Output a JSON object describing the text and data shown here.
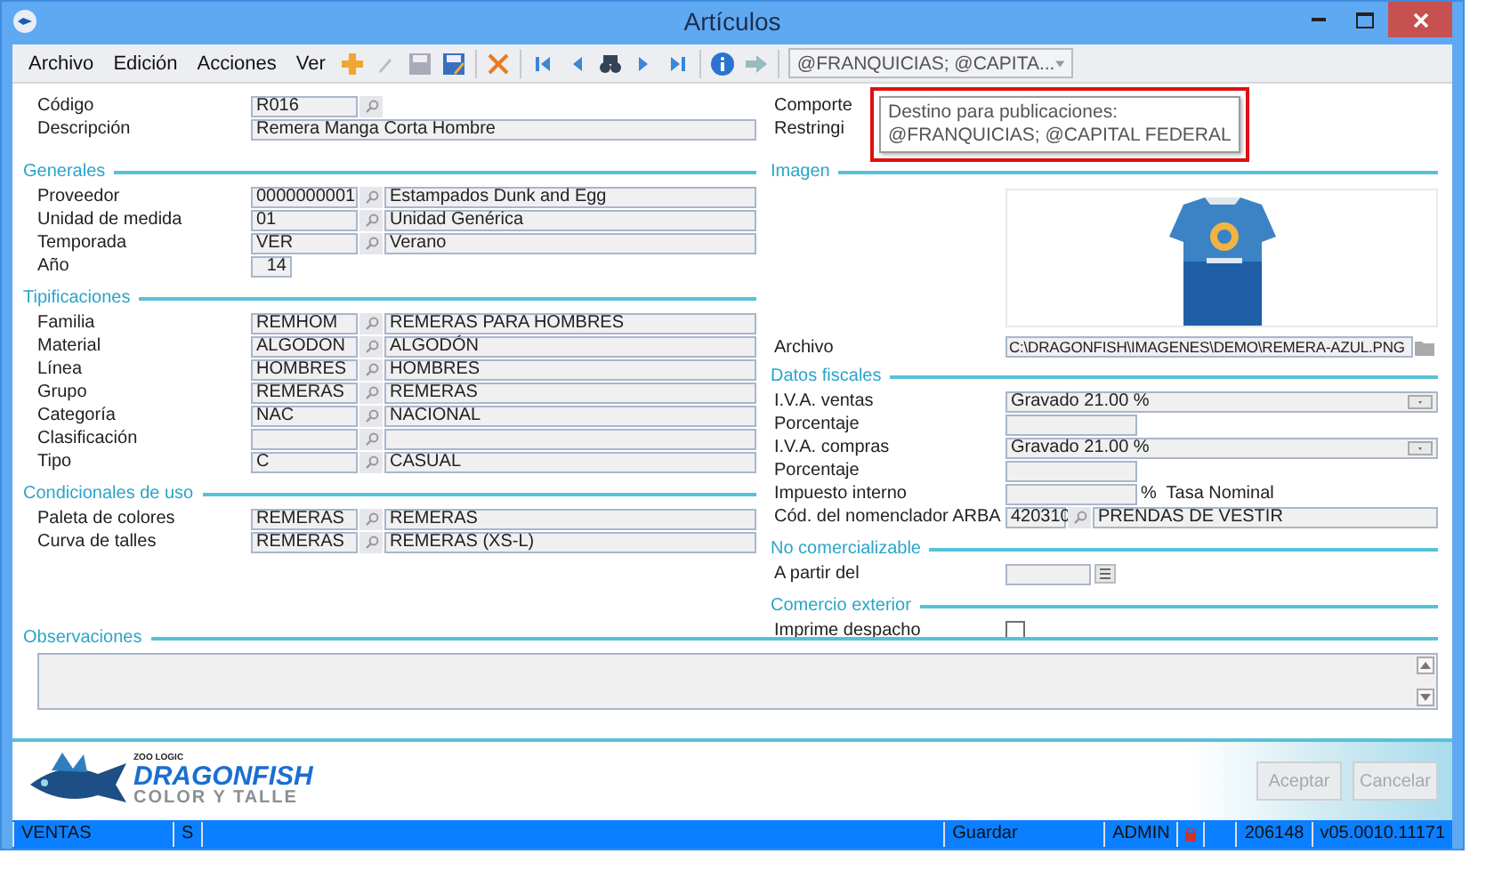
{
  "window": {
    "title": "Artículos"
  },
  "menu": [
    "Archivo",
    "Edición",
    "Acciones",
    "Ver"
  ],
  "toolbar": {
    "combo": "@FRANQUICIAS; @CAPITA..."
  },
  "tooltip": {
    "highlighted": true,
    "lines": [
      "Destino para publicaciones:",
      "@FRANQUICIAS; @CAPITAL FEDERAL"
    ]
  },
  "header_fields": [
    {
      "label": "Código",
      "value": "R016",
      "kind": "code"
    },
    {
      "label": "Descripción",
      "value": "Remera Manga Corta Hombre",
      "kind": "text"
    }
  ],
  "left_sections": [
    {
      "title": "Generales",
      "rows": [
        {
          "kind": "lookup",
          "label": "Proveedor",
          "code": "0000000001",
          "description": "Estampados Dunk and Egg"
        },
        {
          "kind": "lookup",
          "label": "Unidad de medida",
          "code": "01",
          "description": "Unidad Genérica"
        },
        {
          "kind": "lookup",
          "label": "Temporada",
          "code": "VER",
          "description": "Verano"
        },
        {
          "kind": "number",
          "label": "Año",
          "code": "14"
        }
      ]
    },
    {
      "title": "Tipificaciones",
      "rows": [
        {
          "kind": "lookup",
          "label": "Familia",
          "code": "REMHOM",
          "description": "REMERAS PARA HOMBRES"
        },
        {
          "kind": "lookup",
          "label": "Material",
          "code": "ALGODON",
          "description": "ALGODÓN"
        },
        {
          "kind": "lookup",
          "label": "Línea",
          "code": "HOMBRES",
          "description": "HOMBRES"
        },
        {
          "kind": "lookup",
          "label": "Grupo",
          "code": "REMERAS",
          "description": "REMERAS"
        },
        {
          "kind": "lookup",
          "label": "Categoría",
          "code": "NAC",
          "description": "NACIONAL"
        },
        {
          "kind": "lookup",
          "label": "Clasificación"
        },
        {
          "kind": "lookup",
          "label": "Tipo",
          "code": "C",
          "description": "CASUAL"
        }
      ]
    },
    {
      "title": "Condicionales de uso",
      "rows": [
        {
          "kind": "lookup",
          "label": "Paleta de colores",
          "code": "REMERAS",
          "description": "REMERAS"
        },
        {
          "kind": "lookup",
          "label": "Curva de talles",
          "code": "REMERAS",
          "description": "REMERAS (XS-L)"
        }
      ]
    }
  ],
  "right_top_labels": [
    "Comporte",
    "Restringi"
  ],
  "image_section": {
    "title": "Imagen",
    "file_label": "Archivo",
    "file": "C:\\DRAGONFISH\\IMAGENES\\DEMO\\REMERA-AZUL.PNG"
  },
  "right_sections": [
    {
      "title": "Datos fiscales",
      "rows": [
        {
          "kind": "select",
          "label": "I.V.A. ventas",
          "value": "Gravado 21.00 %"
        },
        {
          "kind": "input",
          "label": "Porcentaje"
        },
        {
          "kind": "select",
          "label": "I.V.A. compras",
          "value": "Gravado 21.00 %"
        },
        {
          "kind": "input",
          "label": "Porcentaje"
        },
        {
          "kind": "suffix",
          "label": "Impuesto interno",
          "suffix": "%  Tasa Nominal"
        },
        {
          "kind": "lookup",
          "label": "Cód. del nomenclador ARBA",
          "code": "420310",
          "description": "PRENDAS DE VESTIR"
        }
      ]
    },
    {
      "title": "No comercializable",
      "rows": [
        {
          "kind": "date",
          "label": "A partir del"
        }
      ]
    },
    {
      "title": "Comercio exterior",
      "rows": [
        {
          "kind": "checkbox",
          "label": "Imprime despacho",
          "checked": false
        }
      ]
    }
  ],
  "observaciones": {
    "title": "Observaciones"
  },
  "logo": {
    "brand": "ZOO LOGIC",
    "name": "DRAGONFISH",
    "tagline": "COLOR Y TALLE"
  },
  "buttons": [
    {
      "label": "Aceptar",
      "disabled": true
    },
    {
      "label": "Cancelar",
      "disabled": true
    }
  ],
  "status_bar": [
    {
      "kind": "wide",
      "text": "VENTAS"
    },
    {
      "kind": "text",
      "text": "S"
    },
    {
      "kind": "spacer"
    },
    {
      "kind": "wide",
      "text": "Guardar"
    },
    {
      "kind": "text",
      "text": "ADMIN"
    },
    {
      "kind": "lock"
    },
    {
      "kind": "empty"
    },
    {
      "kind": "text",
      "text": "206148"
    },
    {
      "kind": "text",
      "text": "v05.0010.11171"
    }
  ]
}
